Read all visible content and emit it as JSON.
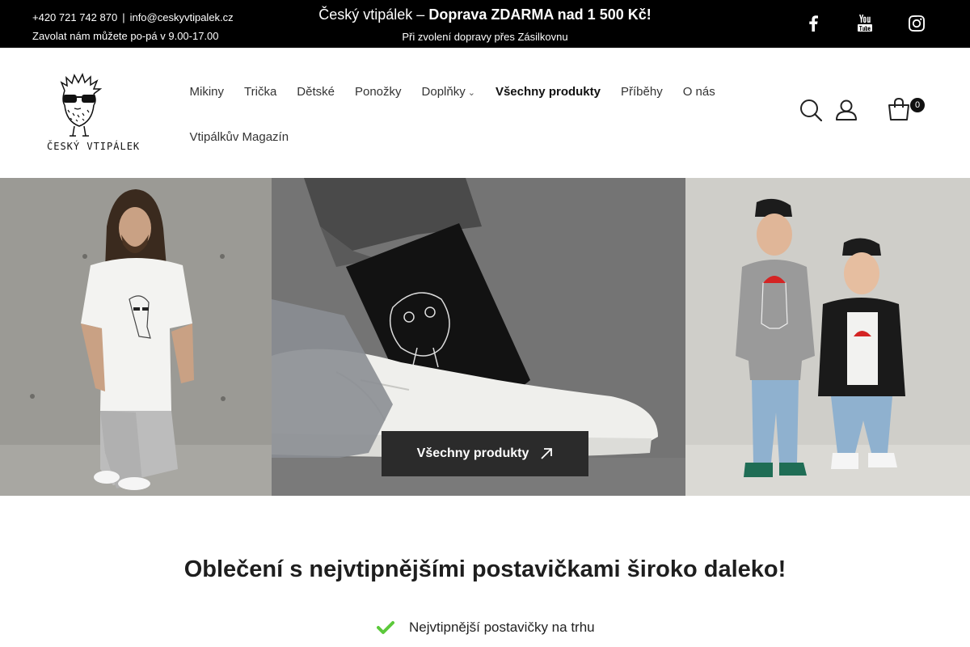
{
  "topbar": {
    "phone": "+420 721 742 870",
    "separator": "|",
    "email": "info@ceskyvtipalek.cz",
    "hours": "Zavolat nám můžete po-pá v 9.00-17.00",
    "promo_prefix": "Český vtipálek – ",
    "promo_bold": "Doprava ZDARMA nad 1 500 Kč!",
    "promo_sub": "Při zvolení dopravy přes Zásilkovnu",
    "social": [
      "facebook-icon",
      "youtube-icon",
      "instagram-icon"
    ]
  },
  "header": {
    "logo_text": "ČESKÝ VTIPÁLEK",
    "nav": [
      {
        "label": "Mikiny"
      },
      {
        "label": "Trička"
      },
      {
        "label": "Dětské"
      },
      {
        "label": "Ponožky"
      },
      {
        "label": "Doplňky"
      },
      {
        "label": "Všechny produkty"
      },
      {
        "label": "Příběhy"
      },
      {
        "label": "O nás"
      },
      {
        "label": "Vtipálkův Magazín"
      }
    ],
    "cart_count": "0",
    "icons": [
      "search-icon",
      "user-icon",
      "cart-icon"
    ]
  },
  "hero": {
    "cta_label": "Všechny produkty"
  },
  "content": {
    "headline": "Oblečení s nejvtipnějšími postavičkami široko daleko!",
    "features": [
      "Nejvtipnější postavičky na trhu"
    ]
  },
  "colors": {
    "topbar_bg": "#000000",
    "cta_bg": "#2b2b2b",
    "check_green": "#5cc93b"
  }
}
